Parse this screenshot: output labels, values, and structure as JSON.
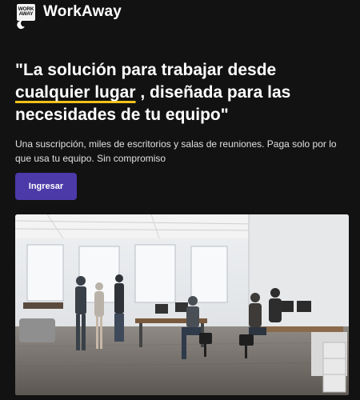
{
  "header": {
    "logo_line1": "WORK",
    "logo_line2": "AWAY",
    "brand": "WorkAway",
    "theme_icon": "moon-icon"
  },
  "hero": {
    "headline_pre": "\"La solución para trabajar desde ",
    "headline_highlight": "cualquier lugar",
    "headline_post": " , diseñada para las necesidades de tu equipo\"",
    "highlight_color": "#f2c21b",
    "subtitle": "Una suscripción, miles de escritorios y salas de reuniones. Paga solo por lo que usa tu equipo. Sin compromiso",
    "cta_label": "Ingresar",
    "cta_color": "#4b3aa8"
  },
  "image": {
    "subject": "office-photo"
  }
}
